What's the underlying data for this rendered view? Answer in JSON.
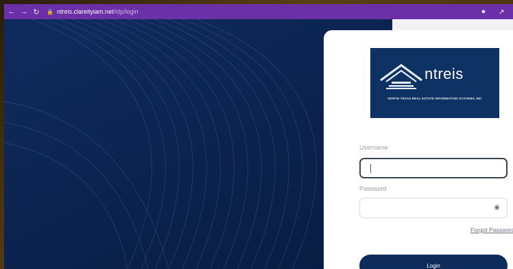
{
  "browser": {
    "url_domain": "ntreis.clareityiam.net",
    "url_path": "/idp/login"
  },
  "logo": {
    "wordmark": "ntreis",
    "tagline": "NORTH TEXAS REAL ESTATE INFORMATION SYSTEMS, INC"
  },
  "form": {
    "username_label": "Username",
    "username_value": "",
    "password_label": "Password",
    "password_value": "",
    "forgot_link": "Forgot Password?",
    "login_button": "Login"
  },
  "colors": {
    "browser_bar": "#6b2fa8",
    "background": "#0b2452",
    "brand_navy": "#0d2c5b"
  },
  "icons": [
    "back-arrow-icon",
    "forward-arrow-icon",
    "reload-icon",
    "lock-icon",
    "location-icon",
    "share-icon",
    "eye-icon",
    "ntreis-building-logo"
  ]
}
